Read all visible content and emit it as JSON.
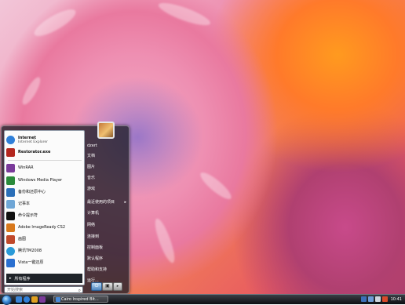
{
  "start_menu": {
    "pinned": [
      {
        "title": "Internet",
        "subtitle": "Internet Explorer",
        "icon": "internet-explorer-icon",
        "color": "#2f7fd8"
      },
      {
        "title": "Restorator.exe",
        "subtitle": "",
        "icon": "restorator-icon",
        "color": "#b3261e"
      }
    ],
    "recent": [
      {
        "label": "WinRAR",
        "icon": "winrar-icon",
        "color": "#7a3a9a"
      },
      {
        "label": "Windows Media Player",
        "icon": "media-player-icon",
        "color": "#2a8a3a"
      },
      {
        "label": "备份和还原中心",
        "icon": "backup-icon",
        "color": "#2b6fb8"
      },
      {
        "label": "记事本",
        "icon": "notepad-icon",
        "color": "#6fa6d6"
      },
      {
        "label": "命令提示符",
        "icon": "cmd-icon",
        "color": "#111111"
      },
      {
        "label": "Adobe ImageReady CS2",
        "icon": "imageready-icon",
        "color": "#d8781c"
      },
      {
        "label": "画图",
        "icon": "paint-icon",
        "color": "#c0482a"
      },
      {
        "label": "腾讯TM2008",
        "icon": "tencent-tm-icon",
        "color": "#2a9ad8"
      },
      {
        "label": "Vista一键还原",
        "icon": "vista-restore-icon",
        "color": "#2a6fd0"
      }
    ],
    "all_programs": "所有程序",
    "search_placeholder": "开始搜索",
    "right_items": [
      {
        "label": "dzert"
      },
      {
        "label": "文档"
      },
      {
        "label": "图片"
      },
      {
        "label": "音乐"
      },
      {
        "label": "游戏"
      },
      {
        "label": "最近使用的项目"
      },
      {
        "label": "计算机"
      },
      {
        "label": "网络"
      },
      {
        "label": "连接到"
      },
      {
        "label": "控制面板"
      },
      {
        "label": "默认程序"
      },
      {
        "label": "帮助和支持"
      },
      {
        "label": "运行..."
      }
    ]
  },
  "taskbar": {
    "task_label": "Cairo Inspired Bit...",
    "clock": "10:41",
    "tray_icons": [
      "keyboard-icon",
      "network-icon",
      "volume-icon",
      "flag-icon"
    ]
  }
}
